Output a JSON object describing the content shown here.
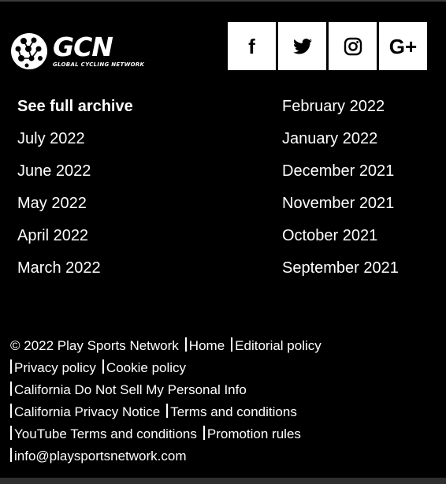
{
  "brand": {
    "logo_text": "GCN",
    "tagline": "GLOBAL CYCLING NETWORK"
  },
  "social": [
    {
      "icon": "facebook-icon",
      "glyph": "f"
    },
    {
      "icon": "twitter-icon",
      "glyph": ""
    },
    {
      "icon": "instagram-icon",
      "glyph": ""
    },
    {
      "icon": "google-plus-icon",
      "glyph": "G+"
    }
  ],
  "archive": {
    "full_archive": "See full archive",
    "left": [
      "July 2022",
      "June 2022",
      "May 2022",
      "April 2022",
      "March 2022"
    ],
    "right": [
      "February 2022",
      "January 2022",
      "December 2021",
      "November 2021",
      "October 2021",
      "September 2021"
    ]
  },
  "legal": {
    "copyright": "© 2022 Play Sports Network",
    "home": "Home",
    "editorial_policy": "Editorial policy",
    "privacy_policy": "Privacy policy",
    "cookie_policy": "Cookie policy",
    "ca_do_not_sell": "California Do Not Sell My Personal Info",
    "ca_privacy_notice": "California Privacy Notice",
    "terms": "Terms and conditions",
    "youtube_terms": "YouTube Terms and conditions",
    "promotion_rules": "Promotion rules",
    "email": "info@playsportsnetwork.com"
  },
  "colors": {
    "background": "#000000",
    "text": "#ffffff",
    "button_bg": "#ffffff",
    "button_icon": "#000000"
  }
}
